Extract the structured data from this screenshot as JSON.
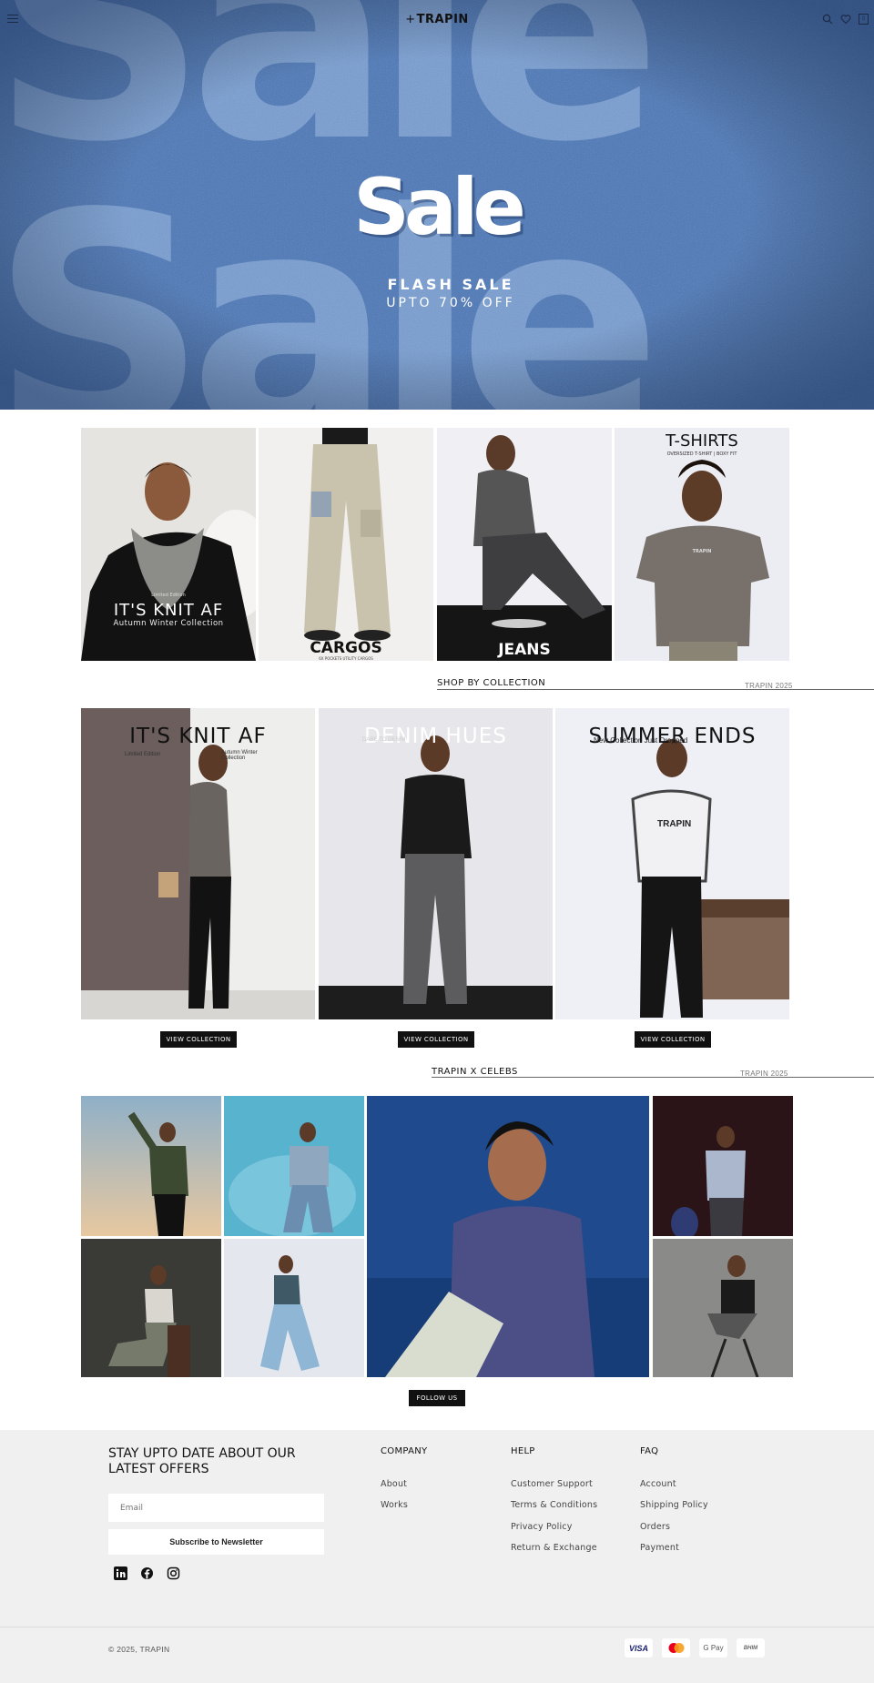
{
  "header": {
    "logo_mark": "+",
    "logo_text": "TRAPIN",
    "icons": [
      "menu-icon",
      "search-icon",
      "heart-icon",
      "cart-icon"
    ],
    "cart_count": "0"
  },
  "hero": {
    "background_word": "Sale",
    "title": "Sale",
    "line1": "FLASH SALE",
    "line2": "UPTO 70% OFF",
    "color": "#4472b4"
  },
  "product_tiles": [
    {
      "small": "Limited Edition",
      "title": "IT'S KNIT AF",
      "sub": "Autumn Winter Collection"
    },
    {
      "title": "CARGOS",
      "sub": "6X POCKETS UTILITY CARGOS"
    },
    {
      "title": "JEANS"
    },
    {
      "title": "T-SHIRTS",
      "sub": "OVERSIZED T-SHIRT | BOXY FIT",
      "print": "TRAPIN"
    }
  ],
  "shop_by_collection": {
    "heading": "SHOP BY COLLECTION",
    "year": "TRAPIN 2025",
    "cards": [
      {
        "title": "IT'S KNIT AF",
        "small_left": "Limited Edition",
        "small_right": "Autumn Winter Collection",
        "button": "VIEW COLLECTION"
      },
      {
        "title": "DENIM HUES",
        "small_left": "DARE TO DENIM",
        "button": "VIEW COLLECTION"
      },
      {
        "title": "SUMMER ENDS",
        "small_left": "New Collection Just Dropped",
        "print": "TRAPIN",
        "button": "VIEW COLLECTION"
      }
    ]
  },
  "celebs": {
    "heading": "TRAPIN X CELEBS",
    "year": "TRAPIN 2025",
    "button": "FOLLOW US"
  },
  "footer": {
    "newsletter_title": "STAY UPTO DATE ABOUT OUR LATEST OFFERS",
    "email_placeholder": "Email",
    "subscribe_label": "Subscribe to Newsletter",
    "social_icons": [
      "linkedin-icon",
      "facebook-icon",
      "instagram-icon"
    ],
    "columns": [
      {
        "heading": "COMPANY",
        "links": [
          "About",
          "Works"
        ]
      },
      {
        "heading": "HELP",
        "links": [
          "Customer Support",
          "Terms & Conditions",
          "Privacy Policy",
          "Return & Exchange"
        ]
      },
      {
        "heading": "FAQ",
        "links": [
          "Account",
          "Shipping Policy",
          "Orders",
          "Payment"
        ]
      }
    ],
    "copyright": "© 2025, TRAPIN",
    "payments": [
      "VISA",
      "mastercard",
      "G Pay",
      "BHIM"
    ]
  }
}
